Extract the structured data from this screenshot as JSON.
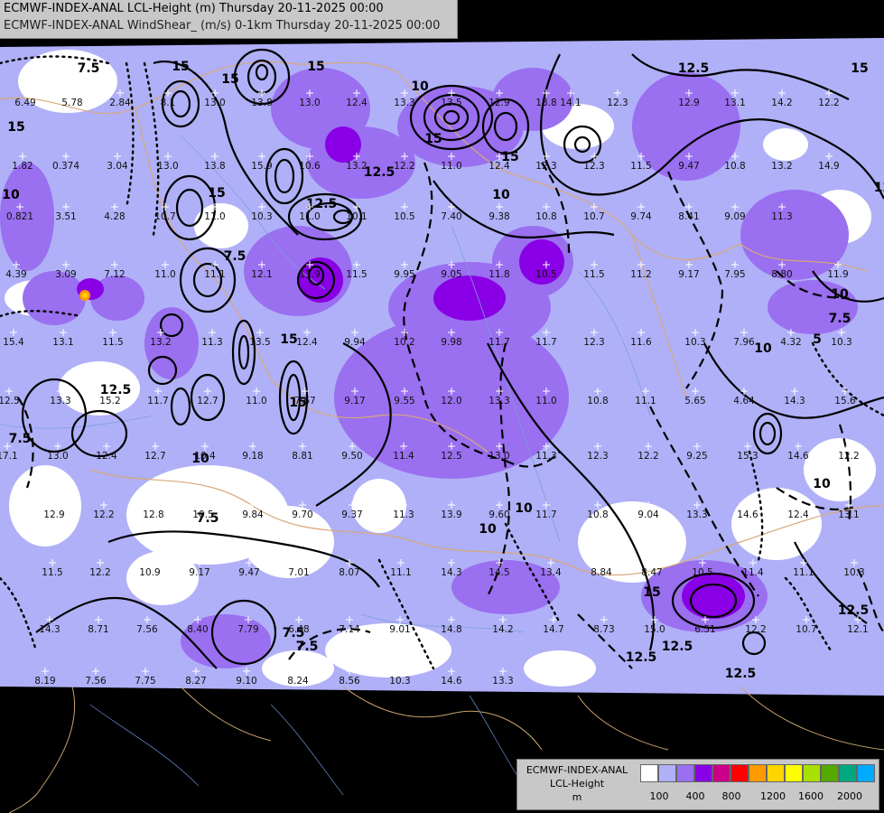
{
  "header": {
    "line1": "ECMWF-INDEX-ANAL LCL-Height (m) Thursday 20-11-2025 00:00",
    "line2": "ECMWF-INDEX-ANAL WindShear_ (m/s) 0-1km Thursday 20-11-2025 00:00"
  },
  "legend": {
    "line1": "ECMWF-INDEX-ANAL",
    "line2": "LCL-Height",
    "line3": "m",
    "colors": [
      "#ffffff",
      "#b0b0f8",
      "#9a6ff0",
      "#8a00e6",
      "#cc0088",
      "#ff0000",
      "#ff9900",
      "#ffd400",
      "#ffff00",
      "#a8e000",
      "#55a800",
      "#00a880",
      "#00aaff"
    ],
    "ticks": [
      "100",
      "400",
      "800",
      "1200",
      "1600",
      "2000"
    ]
  },
  "contour_labels": [
    "7.5",
    "15",
    "15",
    "15",
    "10",
    "12.5",
    "15",
    "15",
    "15",
    "12.5",
    "15",
    "15",
    "12.5",
    "7.5",
    "12.5",
    "10",
    "10",
    "7.5",
    "12.5",
    "7.5",
    "10",
    "7.5",
    "10",
    "12.5",
    "12.5",
    "15",
    "15",
    "7.5",
    "10",
    "12.5",
    "10",
    "15",
    "7.5",
    "12.5",
    "5",
    "10",
    "10"
  ],
  "grid_values": [
    "6.49",
    "5.78",
    "2.84",
    "8.1",
    "13.0",
    "13.8",
    "13.0",
    "12.4",
    "13.3",
    "13.5",
    "12.9",
    "13.8",
    "14.1",
    "12.3",
    "12.9",
    "13.1",
    "14.2",
    "12.2",
    "1.82",
    "0.374",
    "3.04",
    "13.0",
    "13.8",
    "15.9",
    "10.6",
    "13.2",
    "12.2",
    "11.0",
    "12.4",
    "12.3",
    "12.3",
    "11.5",
    "9.47",
    "10.8",
    "13.2",
    "14.9",
    "0.821",
    "3.51",
    "4.28",
    "10.7",
    "11.0",
    "10.3",
    "11.0",
    "10.1",
    "10.5",
    "7.40",
    "9.38",
    "10.8",
    "10.7",
    "9.74",
    "8.41",
    "9.09",
    "11.3",
    "4.39",
    "3.09",
    "7.12",
    "11.0",
    "11.1",
    "12.1",
    "11.9",
    "11.5",
    "9.95",
    "9.05",
    "11.8",
    "10.5",
    "11.5",
    "11.2",
    "9.17",
    "7.95",
    "8.80",
    "11.9",
    "15.4",
    "13.1",
    "11.5",
    "13.2",
    "11.3",
    "13.5",
    "12.4",
    "9.94",
    "10.2",
    "9.98",
    "11.7",
    "11.7",
    "12.3",
    "11.6",
    "10.3",
    "7.96",
    "4.32",
    "10.3",
    "12.5",
    "13.3",
    "15.2",
    "11.7",
    "12.7",
    "11.0",
    "7.67",
    "9.17",
    "9.55",
    "12.0",
    "13.3",
    "11.0",
    "10.8",
    "11.1",
    "5.65",
    "4.64",
    "14.3",
    "15.6",
    "17.1",
    "13.0",
    "12.4",
    "12.7",
    "10.4",
    "9.18",
    "8.81",
    "9.50",
    "11.4",
    "12.5",
    "13.0",
    "11.3",
    "12.3",
    "12.2",
    "9.25",
    "15.3",
    "14.6",
    "12.2",
    "12.9",
    "12.2",
    "12.8",
    "10.5",
    "9.84",
    "9.70",
    "9.37",
    "11.3",
    "13.9",
    "9.60",
    "11.7",
    "10.8",
    "9.04",
    "13.3",
    "14.6",
    "12.4",
    "13.1",
    "11.5",
    "12.2",
    "10.9",
    "9.17",
    "9.47",
    "7.01",
    "8.07",
    "11.1",
    "14.3",
    "14.5",
    "13.4",
    "8.84",
    "8.47",
    "10.5",
    "11.4",
    "11.1",
    "10.3",
    "14.3",
    "8.71",
    "7.56",
    "8.40",
    "7.79",
    "6.48",
    "7.14",
    "9.01",
    "14.8",
    "14.2",
    "14.7",
    "8.73",
    "15.0",
    "6.51",
    "12.2",
    "10.7",
    "12.1",
    "8.19",
    "7.56",
    "7.75",
    "8.27",
    "9.10",
    "8.24",
    "8.56",
    "10.3",
    "14.6",
    "13.3"
  ]
}
